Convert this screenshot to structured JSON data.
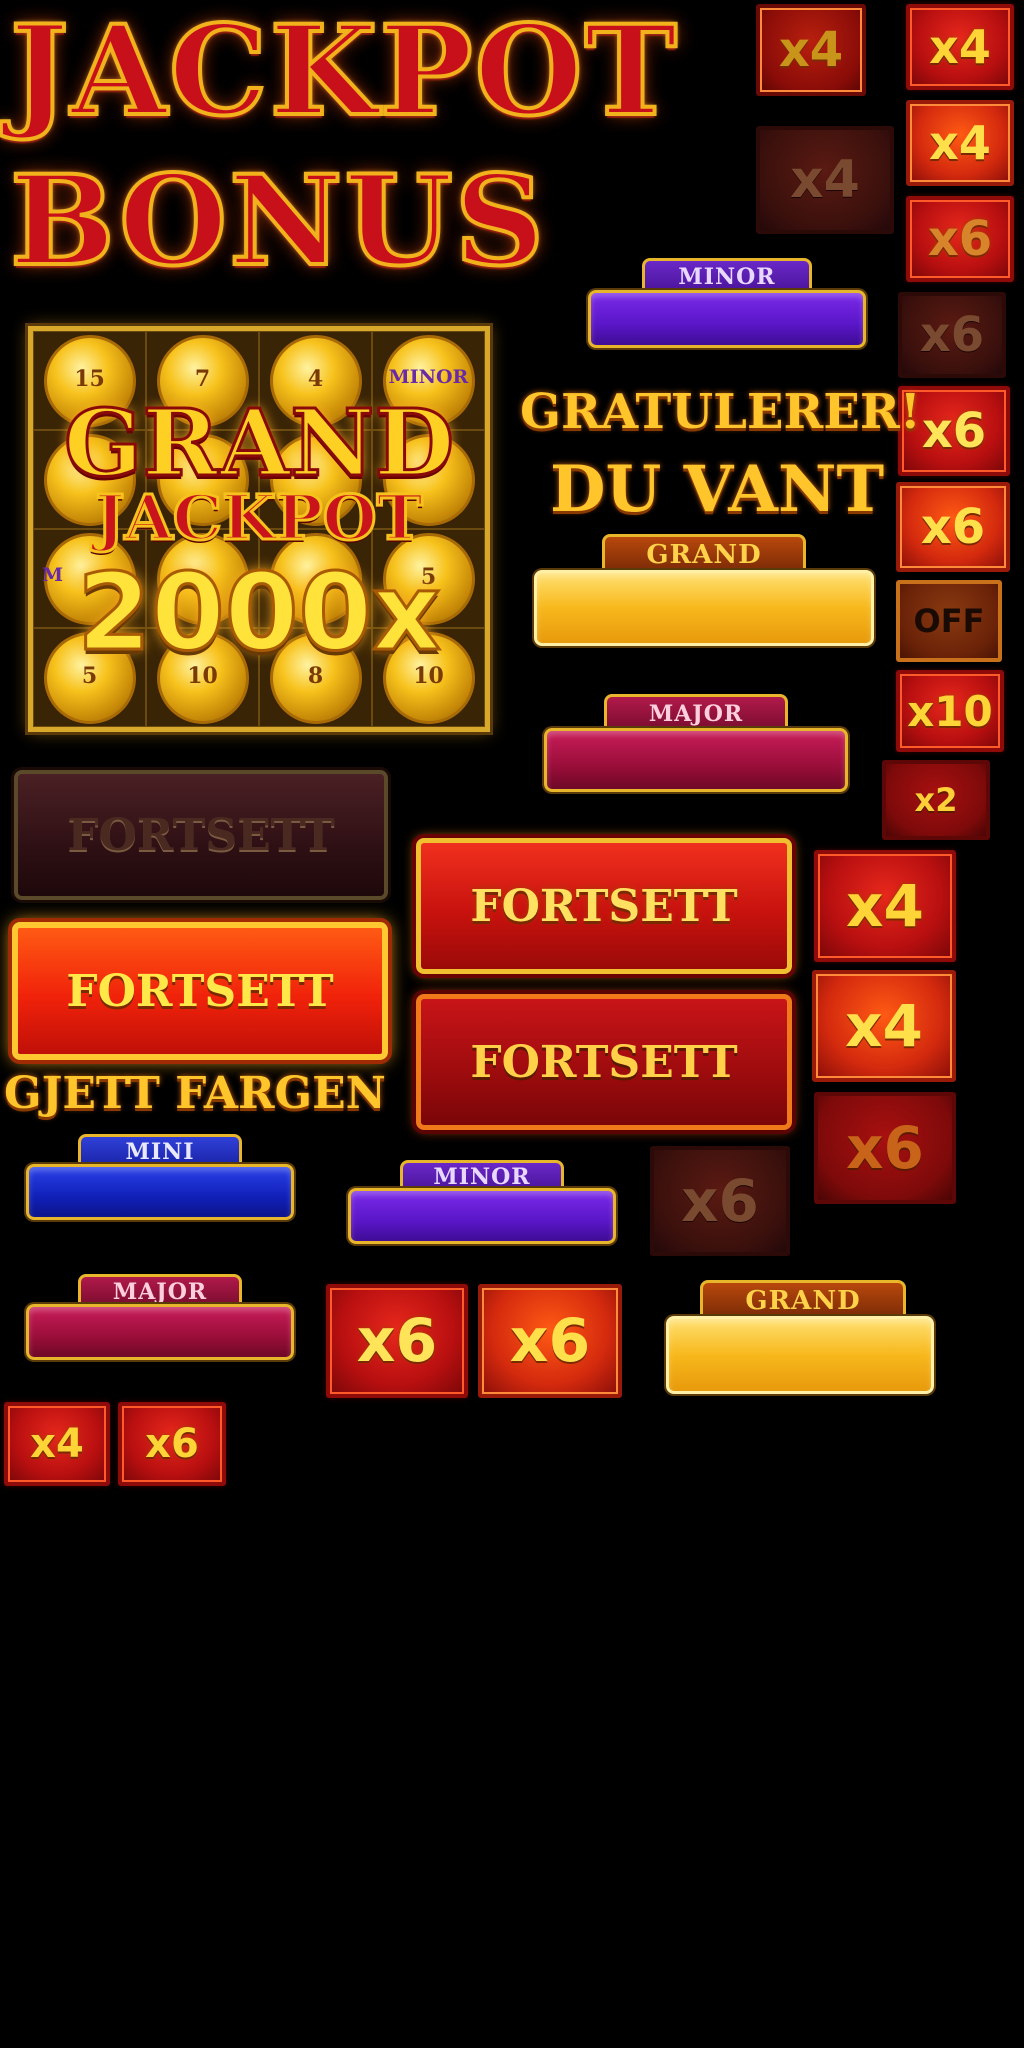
{
  "title": {
    "line1": "JACKPOT",
    "line2": "BONUS"
  },
  "grand_panel": {
    "word1": "GRAND",
    "word2": "JACKPOT",
    "value": "2000x",
    "coin_labels": {
      "c0": "15",
      "c1": "7",
      "c2": "4",
      "c3": "MINOR",
      "m": "M",
      "r5": "5",
      "b0": "5",
      "b1": "10",
      "b2": "8",
      "b3": "10"
    }
  },
  "win_message": {
    "line1": "GRATULERER!",
    "line2": "DU VANT"
  },
  "guess_color": "GJETT FARGEN",
  "jackpot_labels": {
    "mini": "MINI",
    "minor": "MINOR",
    "major": "MAJOR",
    "grand": "GRAND"
  },
  "buttons": {
    "continue": "FORTSETT"
  },
  "tiles": {
    "x2": "x2",
    "x4": "x4",
    "x6": "x6",
    "x10": "x10",
    "off": "OFF"
  }
}
